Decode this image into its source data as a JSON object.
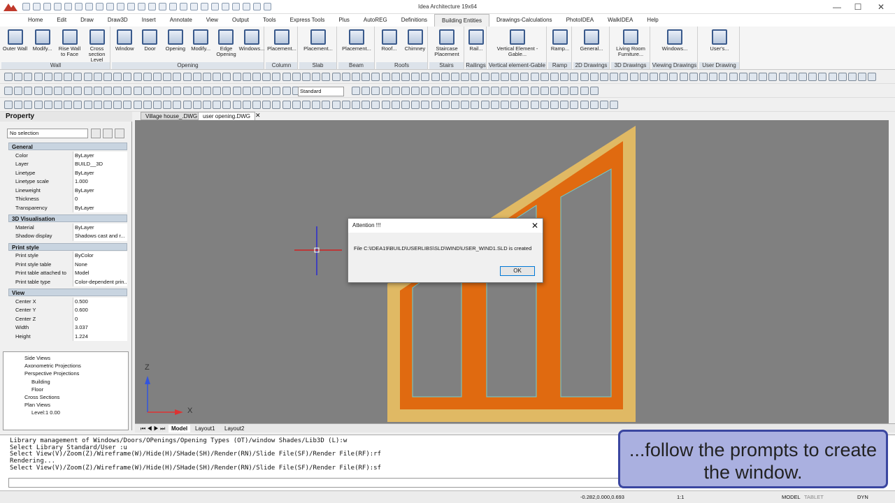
{
  "app": {
    "title": "Idea Architecture 19x64",
    "window_controls": [
      "—",
      "☐",
      "✕"
    ]
  },
  "menu_tabs": [
    "Home",
    "Edit",
    "Draw",
    "Draw3D",
    "Insert",
    "Annotate",
    "View",
    "Output",
    "Tools",
    "Express Tools",
    "Plus",
    "AutoREG",
    "Definitions",
    "Building Entities",
    "Drawings-Calculations",
    "PhotoIDEA",
    "WalkIDEA",
    "Help"
  ],
  "active_tab": "Building Entities",
  "ribbon": {
    "groups": [
      {
        "label": "Wall",
        "buttons": [
          "Outer Wall",
          "Modify...",
          "Rise Wall to Face",
          "Cross section Level"
        ]
      },
      {
        "label": "Opening",
        "buttons": [
          "Window",
          "Door",
          "Opening",
          "Modify...",
          "Edge Opening",
          "Windows..."
        ]
      },
      {
        "label": "Column",
        "buttons": [
          "Placement..."
        ]
      },
      {
        "label": "Slab",
        "buttons": [
          "Placement..."
        ]
      },
      {
        "label": "Beam",
        "buttons": [
          "Placement..."
        ]
      },
      {
        "label": "Roofs",
        "buttons": [
          "Roof...",
          "Chimney"
        ]
      },
      {
        "label": "Stairs",
        "buttons": [
          "Staircase Placement"
        ]
      },
      {
        "label": "Railings",
        "buttons": [
          "Rail..."
        ]
      },
      {
        "label": "Vertical element-Gable",
        "buttons": [
          "Vertical Element - Gable..."
        ]
      },
      {
        "label": "Ramp",
        "buttons": [
          "Ramp..."
        ]
      },
      {
        "label": "2D Drawings",
        "buttons": [
          "General..."
        ]
      },
      {
        "label": "3D Drawings",
        "buttons": [
          "Living Room Furniture..."
        ]
      },
      {
        "label": "Viewing Drawings",
        "buttons": [
          "Windows..."
        ]
      },
      {
        "label": "User Drawing",
        "buttons": [
          "User's..."
        ]
      }
    ]
  },
  "toolbar": {
    "text_style": "Standard"
  },
  "property_panel": {
    "title": "Property",
    "selection": "No selection",
    "sections": [
      {
        "name": "General",
        "rows": [
          [
            "Color",
            "ByLayer"
          ],
          [
            "Layer",
            "BUILD__3D"
          ],
          [
            "Linetype",
            "ByLayer"
          ],
          [
            "Linetype scale",
            "1.000"
          ],
          [
            "Lineweight",
            "ByLayer"
          ],
          [
            "Thickness",
            "0"
          ],
          [
            "Transparency",
            "ByLayer"
          ]
        ]
      },
      {
        "name": "3D Visualisation",
        "rows": [
          [
            "Material",
            "ByLayer"
          ],
          [
            "Shadow display",
            "Shadows cast and r..."
          ]
        ]
      },
      {
        "name": "Print style",
        "rows": [
          [
            "Print style",
            "ByColor"
          ],
          [
            "Print style table",
            "None"
          ],
          [
            "Print table attached to",
            "Model"
          ],
          [
            "Print table type",
            "Color-dependent prin..."
          ]
        ]
      },
      {
        "name": "View",
        "rows": [
          [
            "Center X",
            "0.500"
          ],
          [
            "Center Y",
            "0.600"
          ],
          [
            "Center Z",
            "0"
          ],
          [
            "Width",
            "3.037"
          ],
          [
            "Height",
            "1.224"
          ]
        ]
      }
    ]
  },
  "tree": [
    "Side Views",
    "Axonometric Projections",
    "Perspective Projections",
    "Building",
    "Floor",
    "Cross Sections",
    "Plan Views",
    "Level:1  0.00"
  ],
  "doc_tabs": [
    "Village house_.DWG",
    "user opening.DWG"
  ],
  "active_doc": "user opening.DWG",
  "layout_tabs": [
    "Model",
    "Layout1",
    "Layout2"
  ],
  "ucs": {
    "z": "Z",
    "x": "X"
  },
  "command_lines": [
    "Library management of Windows/Doors/OPenings/Opening Types (OT)/window Shades/Lib3D (L):w",
    "Select Library Standard/User :u",
    "Select View(V)/Zoom(Z)/Wireframe(W)/Hide(H)/SHade(SH)/Render(RN)/Slide File(SF)/Render File(RF):rf",
    "Rendering...",
    "Select View(V)/Zoom(Z)/Wireframe(W)/Hide(H)/SHade(SH)/Render(RN)/Slide File(SF)/Render File(RF):sf"
  ],
  "status": {
    "coords": "-0.282,0.000,0.693",
    "scale": "1:1",
    "items": [
      "MODEL",
      "TABLET",
      "DYN"
    ]
  },
  "dialog": {
    "title": "Attention !!!",
    "message": "File C:\\IDEA19\\BUILD\\USERLIBS\\SLD\\WIND\\USER_WIND1.SLD is created",
    "ok": "OK",
    "close": "✕"
  },
  "callout": "...follow the prompts to create the window.",
  "colors": {
    "frame_outer": "#e0b964",
    "frame_inner": "#e06a10",
    "viewport_bg": "#808080",
    "callout_bg": "#aab0e0"
  }
}
